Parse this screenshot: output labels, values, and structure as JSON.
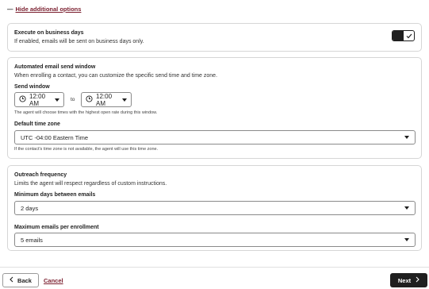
{
  "additional_options": {
    "toggle_symbol": "—",
    "label": "Hide additional options"
  },
  "business_days": {
    "title": "Execute on business days",
    "description": "If enabled, emails will be sent on business days only.",
    "enabled": true
  },
  "send_window": {
    "title": "Automated email send window",
    "description": "When enrolling a contact, you can customize the specific send time and time zone.",
    "label": "Send window",
    "start_time": "12:00 AM",
    "to_label": "to",
    "end_time": "12:00 AM",
    "help": "The agent will choose times with the highest open rate during this window.",
    "timezone_label": "Default time zone",
    "timezone_value": "UTC -04:00 Eastern Time",
    "timezone_help": "If the contact's time zone is not available, the agent will use this time zone."
  },
  "outreach": {
    "title": "Outreach frequency",
    "description": "Limits the agent will respect regardless of custom instructions.",
    "min_days_label": "Minimum days between emails",
    "min_days_value": "2 days",
    "max_emails_label": "Maximum emails per enrollment",
    "max_emails_value": "5 emails"
  },
  "footer": {
    "back_label": "Back",
    "cancel_label": "Cancel",
    "next_label": "Next"
  },
  "colors": {
    "accent": "#7a1e2e",
    "primary_button": "#1f1f1f",
    "border": "#d6d6d6"
  }
}
